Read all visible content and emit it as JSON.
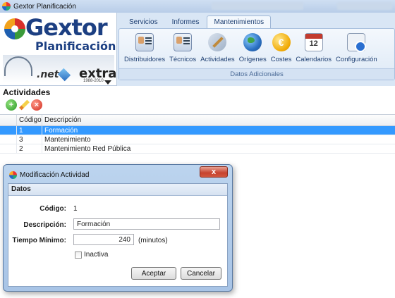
{
  "window": {
    "title": "Gextor Planificación"
  },
  "logo": {
    "name": "Gextor",
    "subtitle": "Planificación",
    "net_badge": ".net",
    "edition": "extra",
    "years": "1988-2010"
  },
  "ribbon": {
    "tabs": [
      {
        "label": "Servicios",
        "active": false
      },
      {
        "label": "Informes",
        "active": false
      },
      {
        "label": "Mantenimientos",
        "active": true
      }
    ],
    "buttons": [
      {
        "label": "Distribuidores",
        "icon": "contact-card-icon"
      },
      {
        "label": "Técnicos",
        "icon": "id-card-icon"
      },
      {
        "label": "Actividades",
        "icon": "tools-icon"
      },
      {
        "label": "Orígenes",
        "icon": "globe-icon"
      },
      {
        "label": "Costes",
        "icon": "euro-coin-icon",
        "glyph": "€"
      },
      {
        "label": "Calendarios",
        "icon": "calendar-icon",
        "glyph": "12"
      },
      {
        "label": "Configuración",
        "icon": "settings-document-icon"
      }
    ],
    "group_caption": "Datos Adicionales"
  },
  "main": {
    "section_title": "Actividades",
    "grid": {
      "columns": [
        "Código",
        "Descripción"
      ],
      "rows": [
        {
          "code": "1",
          "description": "Formación",
          "selected": true
        },
        {
          "code": "3",
          "description": "Mantenimiento",
          "selected": false
        },
        {
          "code": "2",
          "description": "Mantenimiento Red Pública",
          "selected": false
        }
      ]
    }
  },
  "dialog": {
    "title": "Modificación Actividad",
    "close_glyph": "x",
    "group_label": "Datos",
    "code_label": "Código:",
    "code_value": "1",
    "description_label": "Descripción:",
    "description_value": "Formación",
    "min_time_label": "Tiempo Mínimo:",
    "min_time_value": "240",
    "min_time_unit": "(minutos)",
    "inactive_label": "Inactiva",
    "inactive_checked": false,
    "accept_label": "Aceptar",
    "cancel_label": "Cancelar"
  }
}
